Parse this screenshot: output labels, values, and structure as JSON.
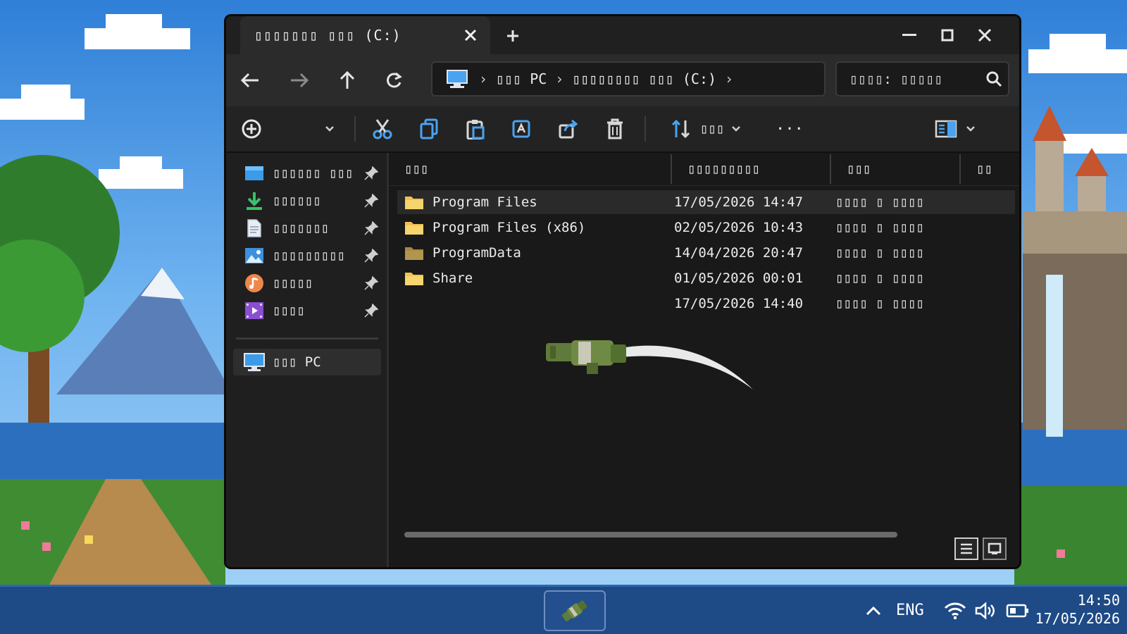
{
  "window": {
    "tab_title": "▯▯▯▯▯▯▯ ▯▯▯ (C:)",
    "new_tab_label": "+"
  },
  "address": {
    "crumbs": [
      "▯▯▯ PC",
      "▯▯▯▯▯▯▯▯ ▯▯▯ (C:)"
    ]
  },
  "search": {
    "placeholder": "▯▯▯▯: ▯▯▯▯▯"
  },
  "toolbar": {
    "sort_label": "▯▯▯",
    "more_label": "···"
  },
  "sidebar": {
    "items": [
      {
        "label": "▯▯▯▯▯▯ ▯▯▯",
        "icon": "desktop-icon"
      },
      {
        "label": "▯▯▯▯▯▯",
        "icon": "download-icon"
      },
      {
        "label": "▯▯▯▯▯▯▯",
        "icon": "document-icon"
      },
      {
        "label": "▯▯▯▯▯▯▯▯▯",
        "icon": "pictures-icon"
      },
      {
        "label": "▯▯▯▯▯",
        "icon": "music-icon"
      },
      {
        "label": "▯▯▯▯",
        "icon": "videos-icon"
      }
    ],
    "this_pc": "▯▯▯ PC"
  },
  "columns": {
    "name": "▯▯▯",
    "date": "▯▯▯▯▯▯▯▯▯",
    "type": "▯▯▯",
    "size": "▯▯"
  },
  "files": [
    {
      "name": "Program Files",
      "date": "17/05/2026 14:47",
      "type": "▯▯▯▯ ▯ ▯▯▯▯"
    },
    {
      "name": "Program Files (x86)",
      "date": "02/05/2026 10:43",
      "type": "▯▯▯▯ ▯ ▯▯▯▯"
    },
    {
      "name": "ProgramData",
      "date": "14/04/2026 20:47",
      "type": "▯▯▯▯ ▯ ▯▯▯▯"
    },
    {
      "name": "Share",
      "date": "01/05/2026 00:01",
      "type": "▯▯▯▯ ▯ ▯▯▯▯"
    },
    {
      "name": "",
      "date": "17/05/2026 14:40",
      "type": "▯▯▯▯ ▯ ▯▯▯▯"
    }
  ],
  "taskbar": {
    "language": "ENG",
    "time": "14:50",
    "date": "17/05/2026"
  },
  "colors": {
    "folder": "#f2c14e",
    "accent": "#4aa3f0",
    "taskbar": "#1e4a86"
  }
}
